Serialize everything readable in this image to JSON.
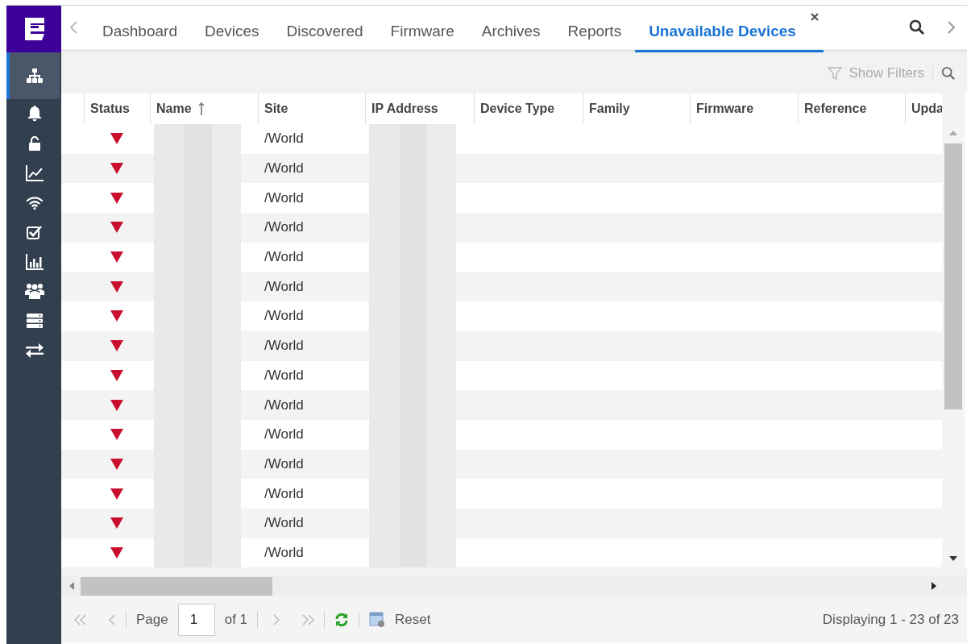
{
  "sidebar": {
    "items": [
      {
        "kind": "topology",
        "selected": true
      },
      {
        "kind": "bell",
        "selected": false
      },
      {
        "kind": "lock",
        "selected": false
      },
      {
        "kind": "trend",
        "selected": false
      },
      {
        "kind": "wifi",
        "selected": false
      },
      {
        "kind": "check",
        "selected": false
      },
      {
        "kind": "bars",
        "selected": false
      },
      {
        "kind": "users",
        "selected": false
      },
      {
        "kind": "server",
        "selected": false
      },
      {
        "kind": "swap",
        "selected": false
      }
    ]
  },
  "tabs": [
    {
      "label": "Dashboard",
      "selected": false
    },
    {
      "label": "Devices",
      "selected": false
    },
    {
      "label": "Discovered",
      "selected": false
    },
    {
      "label": "Firmware",
      "selected": false
    },
    {
      "label": "Archives",
      "selected": false
    },
    {
      "label": "Reports",
      "selected": false
    },
    {
      "label": "Unavailable Devices",
      "selected": true,
      "closable": true
    }
  ],
  "toolbar": {
    "show_filters": "Show Filters"
  },
  "table": {
    "columns": [
      {
        "label": "Status"
      },
      {
        "label": "Name",
        "sort_ascending": true
      },
      {
        "label": "Site"
      },
      {
        "label": "IP Address"
      },
      {
        "label": "Device Type"
      },
      {
        "label": "Family"
      },
      {
        "label": "Firmware"
      },
      {
        "label": "Reference"
      },
      {
        "label": "Upda"
      }
    ],
    "rows": [
      {
        "online": false,
        "site": "/World"
      },
      {
        "online": false,
        "site": "/World"
      },
      {
        "online": false,
        "site": "/World"
      },
      {
        "online": false,
        "site": "/World"
      },
      {
        "online": false,
        "site": "/World"
      },
      {
        "online": false,
        "site": "/World"
      },
      {
        "online": false,
        "site": "/World"
      },
      {
        "online": false,
        "site": "/World"
      },
      {
        "online": false,
        "site": "/World"
      },
      {
        "online": false,
        "site": "/World"
      },
      {
        "online": false,
        "site": "/World"
      },
      {
        "online": false,
        "site": "/World"
      },
      {
        "online": false,
        "site": "/World"
      },
      {
        "online": false,
        "site": "/World"
      },
      {
        "online": false,
        "site": "/World"
      }
    ]
  },
  "pager": {
    "page_label": "Page",
    "page_value": "1",
    "of_label": "of 1",
    "reset": "Reset",
    "summary": "Displaying 1 - 23 of 23"
  }
}
